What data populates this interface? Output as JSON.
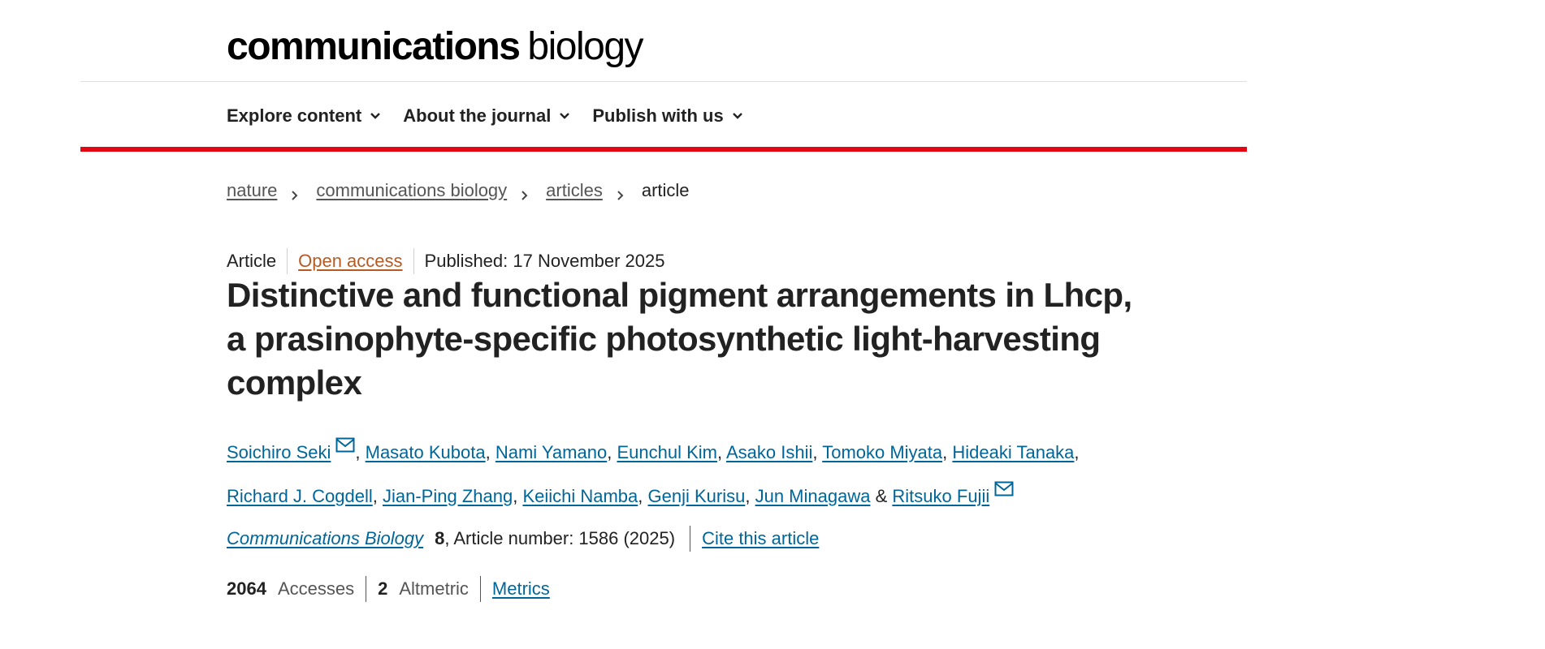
{
  "logo": {
    "bold": "communications",
    "light": "biology"
  },
  "nav": {
    "items": [
      {
        "label": "Explore content"
      },
      {
        "label": "About the journal"
      },
      {
        "label": "Publish with us"
      }
    ]
  },
  "breadcrumb": {
    "items": [
      "nature",
      "communications biology",
      "articles"
    ],
    "current": "article"
  },
  "meta": {
    "type": "Article",
    "access": "Open access",
    "published": "Published: 17 November 2025"
  },
  "title": "Distinctive and functional pigment arrangements in Lhcp, a prasinophyte-specific photosynthetic light-harvesting complex",
  "authors": [
    "Soichiro Seki",
    "Masato Kubota",
    "Nami Yamano",
    "Eunchul Kim",
    "Asako Ishii",
    "Tomoko Miyata",
    "Hideaki Tanaka",
    "Richard J. Cogdell",
    "Jian-Ping Zhang",
    "Keiichi Namba",
    "Genji Kurisu",
    "Jun Minagawa",
    "Ritsuko Fujii"
  ],
  "authors_joiner": "&",
  "citation": {
    "journal": "Communications Biology",
    "volume": "8",
    "rest": ", Article number: 1586 (2025)",
    "cite_label": "Cite this article"
  },
  "metrics": {
    "accesses_count": "2064",
    "accesses_label": "Accesses",
    "altmetric_count": "2",
    "altmetric_label": "Altmetric",
    "metrics_link": "Metrics"
  },
  "colors": {
    "accent_red": "#e30613",
    "link_blue": "#006699",
    "open_access": "#b65a23"
  }
}
